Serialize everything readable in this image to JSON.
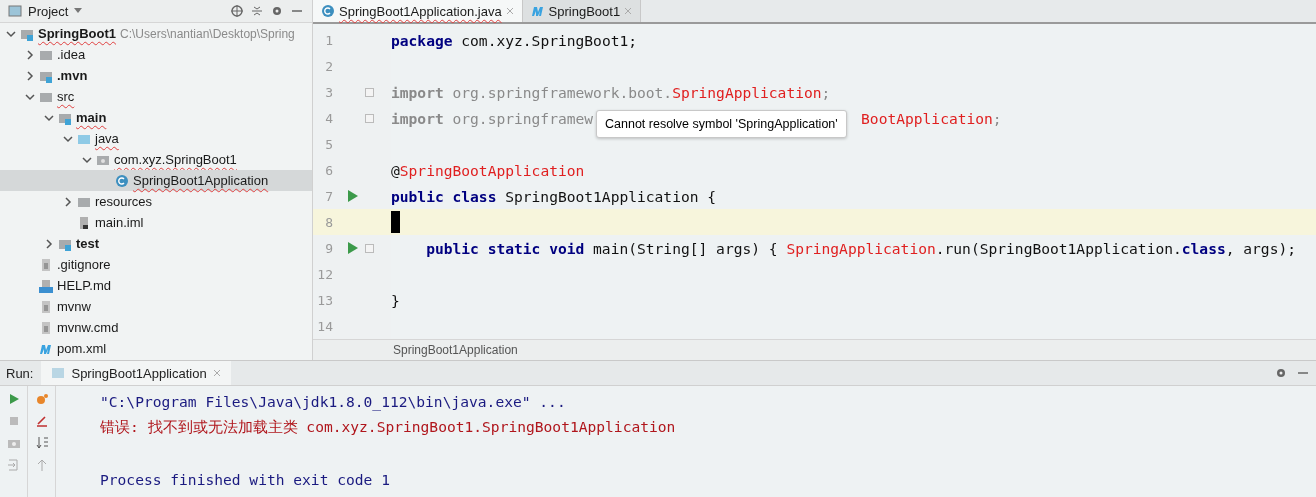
{
  "project_panel": {
    "title": "Project",
    "tree": [
      {
        "name": "SpringBoot1",
        "bold": true,
        "path": "C:\\Users\\nantian\\Desktop\\Spring",
        "kind": "module",
        "expanded": true,
        "selected": false,
        "squiggle": true,
        "children": [
          {
            "name": ".idea",
            "kind": "folder",
            "expanded": false,
            "selected": false
          },
          {
            "name": ".mvn",
            "bold": true,
            "kind": "module",
            "expanded": false,
            "selected": false
          },
          {
            "name": "src",
            "kind": "folder",
            "expanded": true,
            "selected": false,
            "squiggle": true,
            "children": [
              {
                "name": "main",
                "bold": true,
                "kind": "module",
                "expanded": true,
                "selected": false,
                "squiggle": true,
                "children": [
                  {
                    "name": "java",
                    "kind": "source",
                    "expanded": true,
                    "selected": false,
                    "squiggle": true,
                    "children": [
                      {
                        "name": "com.xyz.SpringBoot1",
                        "kind": "package",
                        "expanded": true,
                        "selected": false,
                        "squiggle": true,
                        "children": [
                          {
                            "name": "SpringBoot1Application",
                            "kind": "class",
                            "selected": true,
                            "squiggle": true
                          }
                        ]
                      }
                    ]
                  },
                  {
                    "name": "resources",
                    "kind": "folder",
                    "expanded": false,
                    "selected": false
                  },
                  {
                    "name": "main.iml",
                    "kind": "iml",
                    "selected": false
                  }
                ]
              },
              {
                "name": "test",
                "bold": true,
                "kind": "module",
                "expanded": false,
                "selected": false
              }
            ]
          },
          {
            "name": ".gitignore",
            "kind": "file",
            "selected": false
          },
          {
            "name": "HELP.md",
            "kind": "md",
            "selected": false
          },
          {
            "name": "mvnw",
            "kind": "file",
            "selected": false
          },
          {
            "name": "mvnw.cmd",
            "kind": "file",
            "selected": false
          },
          {
            "name": "pom.xml",
            "kind": "maven",
            "selected": false
          }
        ]
      }
    ]
  },
  "editor": {
    "tabs": [
      {
        "label": "SpringBoot1Application.java",
        "kind": "class",
        "selected": true,
        "squiggle": true
      },
      {
        "label": "SpringBoot1",
        "kind": "maven",
        "selected": false,
        "squiggle": false
      }
    ],
    "lines": [
      {
        "number": "1",
        "current": false,
        "tokens": [
          {
            "kind": "keyword",
            "text": "package"
          },
          {
            "kind": "plain",
            "text": " com.xyz.SpringBoot1;"
          }
        ]
      },
      {
        "number": "2",
        "current": false
      },
      {
        "number": "3",
        "current": false,
        "fold": true,
        "tokens": [
          {
            "kind": "dim-keyword",
            "text": "import"
          },
          {
            "kind": "dim",
            "text": " org.springframework.boot."
          },
          {
            "kind": "error",
            "text": "SpringApplication"
          },
          {
            "kind": "dim",
            "text": ";"
          }
        ]
      },
      {
        "number": "4",
        "current": false,
        "fold": true,
        "tokens": [
          {
            "kind": "dim-keyword",
            "text": "import"
          },
          {
            "kind": "dim",
            "text": " org.springframew"
          },
          {
            "kind": "gap"
          },
          {
            "kind": "error",
            "text": "BootApplication"
          },
          {
            "kind": "dim",
            "text": ";"
          }
        ]
      },
      {
        "number": "5",
        "current": false
      },
      {
        "number": "6",
        "current": false,
        "tokens": [
          {
            "kind": "plain",
            "text": "@"
          },
          {
            "kind": "error",
            "text": "SpringBootApplication"
          }
        ]
      },
      {
        "number": "7",
        "current": false,
        "run": true,
        "tokens": [
          {
            "kind": "keyword",
            "text": "public class"
          },
          {
            "kind": "plain",
            "text": " SpringBoot1Application {"
          }
        ]
      },
      {
        "number": "8",
        "current": true
      },
      {
        "number": "9",
        "current": false,
        "run": true,
        "fold": true,
        "indented": true,
        "tokens": [
          {
            "kind": "keyword",
            "text": "public static void"
          },
          {
            "kind": "plain",
            "text": " main(String[] args) { "
          },
          {
            "kind": "error",
            "text": "SpringApplication"
          },
          {
            "kind": "plain",
            "text": ".run(SpringBoot1Application."
          },
          {
            "kind": "keyword",
            "text": "class"
          },
          {
            "kind": "plain",
            "text": ", args);"
          }
        ]
      },
      {
        "number": "12",
        "current": false
      },
      {
        "number": "13",
        "current": false,
        "tokens": [
          {
            "kind": "plain",
            "text": "}"
          }
        ]
      },
      {
        "number": "14",
        "current": false
      }
    ],
    "tooltip": "Cannot resolve symbol 'SpringApplication'",
    "breadcrumb": "SpringBoot1Application"
  },
  "run_panel": {
    "label": "Run:",
    "tabs": [
      {
        "label": "SpringBoot1Application",
        "selected": true
      }
    ],
    "console": [
      {
        "kind": "command",
        "text": "\"C:\\Program Files\\Java\\jdk1.8.0_112\\bin\\java.exe\" ..."
      },
      {
        "kind": "error",
        "text": "错误: 找不到或无法加载主类 com.xyz.SpringBoot1.SpringBoot1Application"
      },
      {
        "kind": "blank"
      },
      {
        "kind": "info",
        "text": "Process finished with exit code 1"
      }
    ]
  }
}
